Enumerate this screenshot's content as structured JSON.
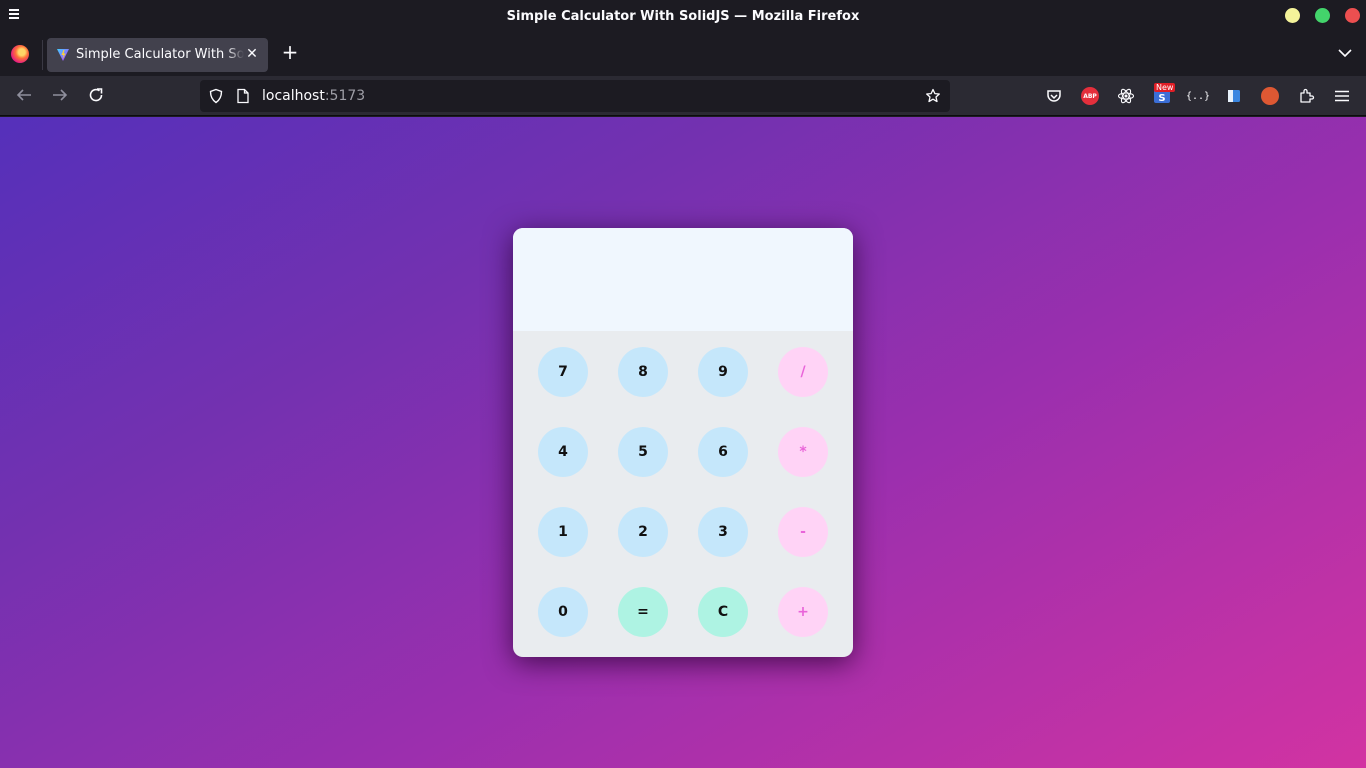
{
  "window": {
    "title": "Simple Calculator With SolidJS — Mozilla Firefox",
    "controls": {
      "minimize": "#f4f39a",
      "maximize": "#43d46b",
      "close": "#ec4f50"
    }
  },
  "tabs": [
    {
      "title": "Simple Calculator With SolidJS",
      "active": true,
      "favicon": "vite-icon"
    }
  ],
  "navbar": {
    "url_host": "localhost",
    "url_port": ":5173",
    "extensions": [
      "pocket-icon",
      "adblock-plus-icon",
      "react-devtools-icon",
      "news-extension-icon",
      "json-viewer-icon",
      "sidebar-extension-icon",
      "duckduckgo-icon",
      "extensions-icon"
    ],
    "abp_label": "ABP",
    "news_badge": "New",
    "braces_label": "{..}"
  },
  "calculator": {
    "display": "",
    "keys": [
      {
        "label": "7",
        "kind": "num"
      },
      {
        "label": "8",
        "kind": "num"
      },
      {
        "label": "9",
        "kind": "num"
      },
      {
        "label": "/",
        "kind": "op"
      },
      {
        "label": "4",
        "kind": "num"
      },
      {
        "label": "5",
        "kind": "num"
      },
      {
        "label": "6",
        "kind": "num"
      },
      {
        "label": "*",
        "kind": "op"
      },
      {
        "label": "1",
        "kind": "num"
      },
      {
        "label": "2",
        "kind": "num"
      },
      {
        "label": "3",
        "kind": "num"
      },
      {
        "label": "-",
        "kind": "op"
      },
      {
        "label": "0",
        "kind": "num"
      },
      {
        "label": "=",
        "kind": "fn"
      },
      {
        "label": "C",
        "kind": "fn"
      },
      {
        "label": "+",
        "kind": "op"
      }
    ]
  },
  "colors": {
    "number_key": "#c5e7fb",
    "operator_key": "#ffd3f6",
    "operator_text": "#e964d9",
    "function_key": "#aef3e3",
    "display_bg": "#f0f7fe",
    "keypad_bg": "#e9ecef",
    "page_gradient": [
      "#5530ba",
      "#d233a2"
    ]
  }
}
